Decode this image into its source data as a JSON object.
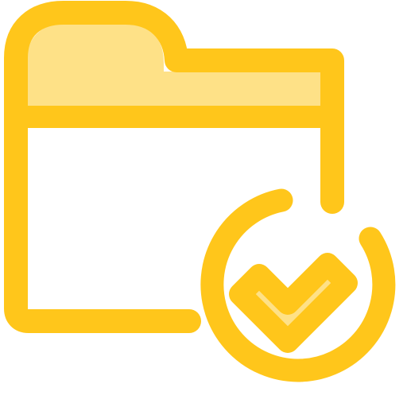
{
  "icon": {
    "name": "folder-check-icon",
    "colors": {
      "stroke": "#FFC61B",
      "fill_light": "#FEE187",
      "background": "#FFFFFF"
    }
  }
}
